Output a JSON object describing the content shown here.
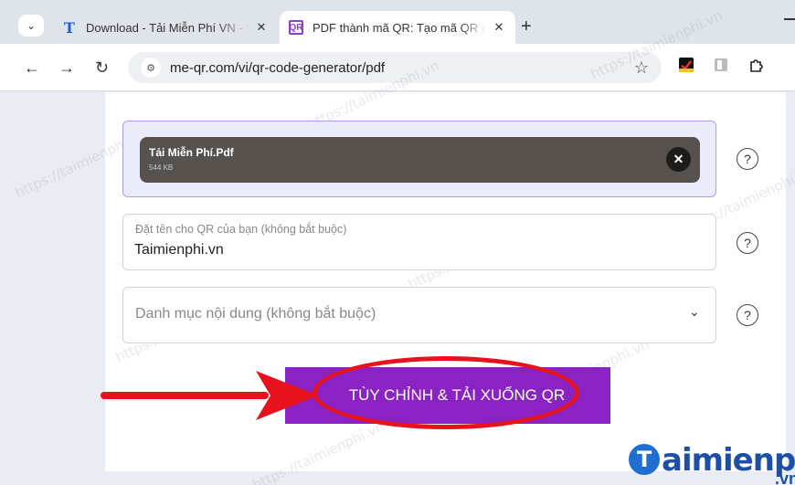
{
  "browser": {
    "tabs": [
      {
        "label": "Download - Tải Miễn Phí VN - P",
        "favicon": "T",
        "active": false
      },
      {
        "label": "PDF thành mã QR: Tạo mã QR c",
        "favicon": "QR",
        "active": true
      }
    ],
    "close_glyph": "✕",
    "new_tab": "+",
    "tab_menu": "⌄",
    "url": "me-qr.com/vi/qr-code-generator/pdf"
  },
  "form": {
    "file": {
      "name": "Tải Miễn Phí.Pdf",
      "size": "544 KB",
      "remove": "✕"
    },
    "qr_name": {
      "placeholder": "Đặt tên cho QR của bạn (không bắt buộc)",
      "value": "Taimienphi.vn"
    },
    "category": {
      "placeholder": "Danh mục nội dung (không bắt buộc)"
    },
    "help": "?",
    "submit": "TÙY CHỈNH & TẢI XUỐNG QR"
  },
  "colors": {
    "accent": "#8b23c4",
    "annotation": "#e8121c",
    "chip": "#58524f"
  },
  "logo": {
    "text": "aimienphi",
    "initial": "T",
    "suffix": ".vn"
  },
  "watermark": "https://taimienphi.vn"
}
